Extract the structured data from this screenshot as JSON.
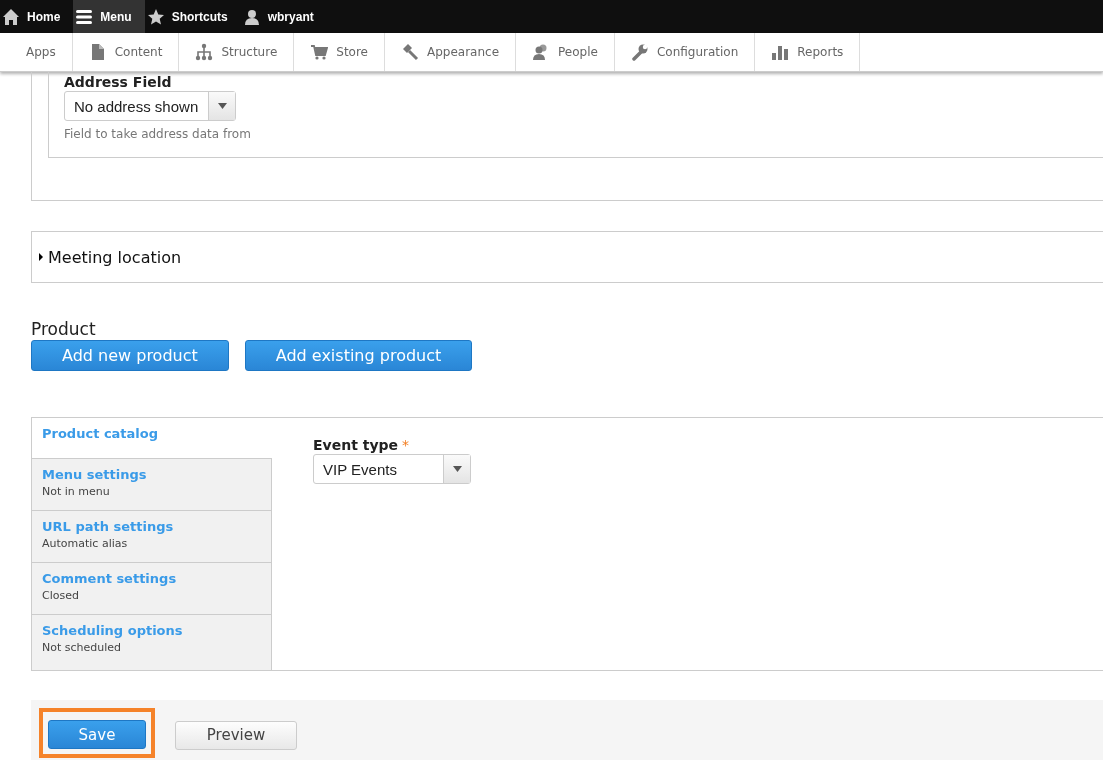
{
  "toolbar": {
    "items": [
      {
        "label": "Home",
        "selected": false
      },
      {
        "label": "Menu",
        "selected": true
      },
      {
        "label": "Shortcuts",
        "selected": false
      },
      {
        "label": "wbryant",
        "selected": false
      }
    ]
  },
  "admin_menu": {
    "items": [
      {
        "label": "Apps"
      },
      {
        "label": "Content"
      },
      {
        "label": "Structure"
      },
      {
        "label": "Store"
      },
      {
        "label": "Appearance"
      },
      {
        "label": "People"
      },
      {
        "label": "Configuration"
      },
      {
        "label": "Reports"
      }
    ]
  },
  "address_field": {
    "label": "Address Field",
    "value": "No address shown",
    "description": "Field to take address data from"
  },
  "meeting_location": {
    "title": "Meeting location",
    "expanded": false
  },
  "product": {
    "heading": "Product",
    "buttons": [
      "Add new product",
      "Add existing product"
    ]
  },
  "vertical_tabs": [
    {
      "title": "Product catalog",
      "selected": true
    },
    {
      "title": "Menu settings",
      "summary": "Not in menu",
      "selected": false
    },
    {
      "title": "URL path settings",
      "summary": "Automatic alias",
      "selected": false
    },
    {
      "title": "Comment settings",
      "summary": "Closed",
      "selected": false
    },
    {
      "title": "Scheduling options",
      "summary": "Not scheduled",
      "selected": false
    }
  ],
  "event_type": {
    "label": "Event type",
    "required": true,
    "required_mark": "*",
    "value": "VIP Events"
  },
  "actions": [
    {
      "label": "Save",
      "kind": "primary",
      "highlighted": true
    },
    {
      "label": "Preview",
      "kind": "secondary",
      "highlighted": false
    }
  ]
}
